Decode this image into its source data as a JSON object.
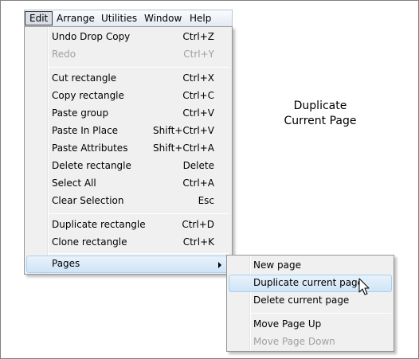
{
  "menubar": {
    "items": [
      "Edit",
      "Arrange",
      "Utilities",
      "Window",
      "Help"
    ]
  },
  "edit_menu": {
    "items": [
      {
        "label": "Undo Drop Copy",
        "shortcut": "Ctrl+Z",
        "enabled": true
      },
      {
        "label": "Redo",
        "shortcut": "Ctrl+Y",
        "enabled": false
      },
      {
        "label": "Cut rectangle",
        "shortcut": "Ctrl+X",
        "enabled": true
      },
      {
        "label": "Copy rectangle",
        "shortcut": "Ctrl+C",
        "enabled": true
      },
      {
        "label": "Paste group",
        "shortcut": "Ctrl+V",
        "enabled": true
      },
      {
        "label": "Paste In Place",
        "shortcut": "Shift+Ctrl+V",
        "enabled": true
      },
      {
        "label": "Paste Attributes",
        "shortcut": "Shift+Ctrl+A",
        "enabled": true
      },
      {
        "label": "Delete rectangle",
        "shortcut": "Delete",
        "enabled": true
      },
      {
        "label": "Select All",
        "shortcut": "Ctrl+A",
        "enabled": true
      },
      {
        "label": "Clear Selection",
        "shortcut": "Esc",
        "enabled": true
      },
      {
        "label": "Duplicate rectangle",
        "shortcut": "Ctrl+D",
        "enabled": true
      },
      {
        "label": "Clone rectangle",
        "shortcut": "Ctrl+K",
        "enabled": true
      },
      {
        "label": "Pages",
        "shortcut": "",
        "enabled": true
      }
    ]
  },
  "pages_submenu": {
    "items": [
      {
        "label": "New page",
        "enabled": true
      },
      {
        "label": "Duplicate current page",
        "enabled": true
      },
      {
        "label": "Delete current page",
        "enabled": true
      },
      {
        "label": "Move Page Up",
        "enabled": true
      },
      {
        "label": "Move Page Down",
        "enabled": false
      }
    ]
  },
  "caption": {
    "line1": "Duplicate",
    "line2": "Current Page"
  },
  "icons": {
    "submenu_arrow": "chevron-right-icon",
    "pointer": "mouse-pointer-icon"
  },
  "colors": {
    "highlight": "#cfe4f7",
    "highlight_border": "#a8d0f0",
    "disabled_text": "#a0a0a0"
  }
}
